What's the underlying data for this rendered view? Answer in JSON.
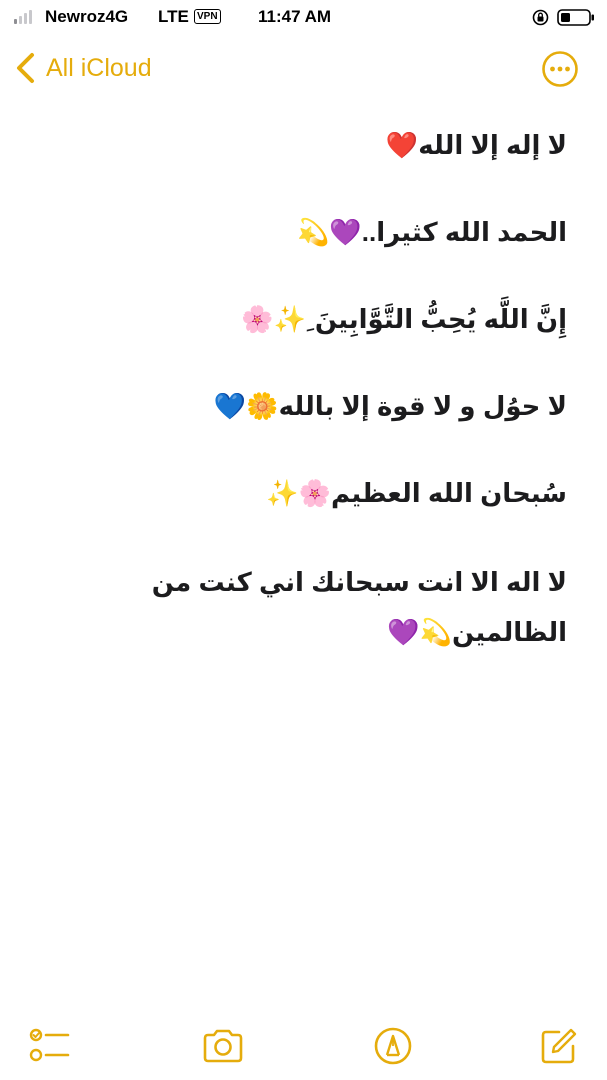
{
  "status_bar": {
    "carrier": "Newroz4G",
    "network": "LTE",
    "vpn": "VPN",
    "time": "11:47 AM"
  },
  "nav": {
    "back_label": "All iCloud",
    "back_icon": "chevron-left-icon",
    "more_icon": "ellipsis-circle-icon"
  },
  "accent_color": "#e5ac0c",
  "note": {
    "lines": [
      {
        "text": "لا إله إلا الله",
        "emoji": "❤️"
      },
      {
        "text": "الحمد الله كثيرا..",
        "emoji": "💜💫"
      },
      {
        "text": "إِنَّ اللَّه يُحِبُّ التَّوَّابِينَ ِ",
        "emoji": "✨🌸"
      },
      {
        "text": "لا حوُل و لا قوة إلا بالله",
        "emoji": "🌼💙"
      },
      {
        "text": "سُبحان الله العظيم",
        "emoji": "🌸✨"
      },
      {
        "text": "لا اله الا انت سبحانك اني كنت من الظالمين",
        "emoji": "💫💜"
      }
    ]
  },
  "toolbar": {
    "items": [
      {
        "icon": "checklist-icon"
      },
      {
        "icon": "camera-icon"
      },
      {
        "icon": "markup-pen-icon"
      },
      {
        "icon": "compose-icon"
      }
    ]
  }
}
